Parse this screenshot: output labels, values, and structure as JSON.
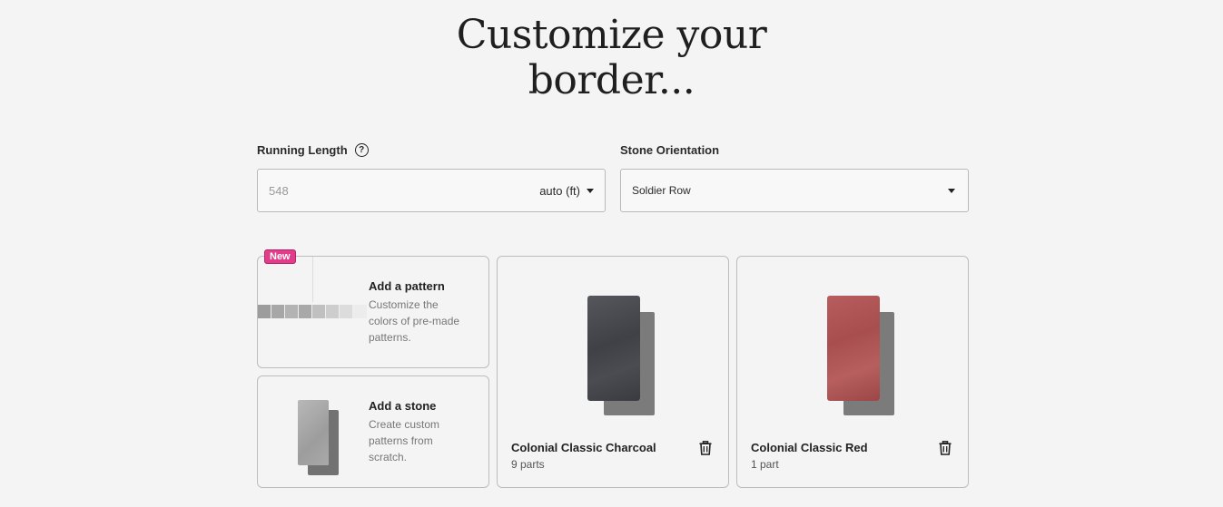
{
  "header": {
    "title_line1": "Customize your",
    "title_line2": "border..."
  },
  "running_length": {
    "label": "Running Length",
    "help_icon": "question-circle-icon",
    "help_glyph": "?",
    "value": "548",
    "unit_label": "auto (ft)"
  },
  "stone_orientation": {
    "label": "Stone Orientation",
    "value": "Soldier Row"
  },
  "add_pattern": {
    "badge": "New",
    "title": "Add a pattern",
    "description": "Customize the colors of pre-made patterns."
  },
  "add_stone": {
    "title": "Add a stone",
    "description": "Create custom patterns from scratch."
  },
  "stones": [
    {
      "name": "Colonial Classic Charcoal",
      "parts": "9 parts",
      "color": "#45474c",
      "icon": "trash-icon"
    },
    {
      "name": "Colonial Classic Red",
      "parts": "1 part",
      "color": "#ac5253",
      "icon": "trash-icon"
    }
  ],
  "colors": {
    "background": "#f4f4f4",
    "badge": "#e23d8a",
    "border": "#bdbdbd"
  }
}
